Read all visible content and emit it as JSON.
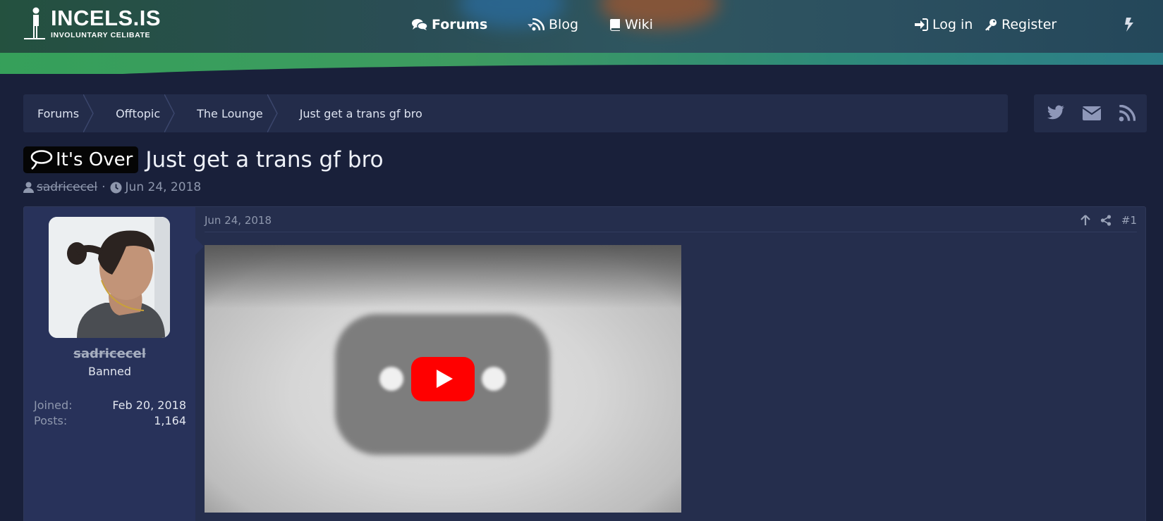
{
  "header": {
    "logo_title": "INCELS.IS",
    "logo_subtitle": "INVOLUNTARY CELIBATE",
    "nav": [
      {
        "label": "Forums",
        "icon": "comments-icon"
      },
      {
        "label": "Blog",
        "icon": "rss-icon"
      },
      {
        "label": "Wiki",
        "icon": "book-icon"
      }
    ],
    "login_label": "Log in",
    "register_label": "Register"
  },
  "breadcrumb": [
    "Forums",
    "Offtopic",
    "The Lounge",
    "Just get a trans gf bro"
  ],
  "share_icons": [
    "twitter-icon",
    "envelope-icon",
    "rss-icon"
  ],
  "thread": {
    "prefix": "It's Over",
    "title": "Just get a trans gf bro",
    "author": "sadricecel",
    "date": "Jun 24, 2018"
  },
  "post": {
    "username": "sadricecel",
    "user_title": "Banned",
    "joined_label": "Joined:",
    "joined_value": "Feb 20, 2018",
    "posts_label": "Posts:",
    "posts_value": "1,164",
    "date": "Jun 24, 2018",
    "number": "#1"
  },
  "colors": {
    "background": "#19203a",
    "panel": "#232c4a",
    "accent_green": "#35a05a",
    "youtube_red": "#ff0000"
  }
}
